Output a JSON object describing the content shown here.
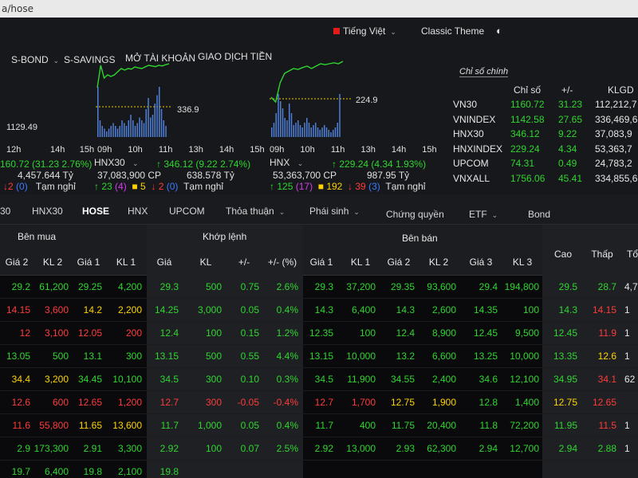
{
  "browser": {
    "url": "a/hose"
  },
  "header": {
    "lang_flag": "vn-flag-icon",
    "language": "Tiếng Việt",
    "theme": "Classic Theme",
    "menu": [
      "S-BOND",
      "S-SAVINGS",
      "MỞ TÀI KHOẢN",
      "GIAO DỊCH TIỀN"
    ]
  },
  "minicharts": [
    {
      "left_label": "1129.49",
      "time_labels": [
        "12h",
        "14h",
        "15h"
      ],
      "change": "160.72 (31.23 2.76%)",
      "volume": "4,457.644 Tỷ",
      "stats": {
        "down": "2",
        "down_b": "(0)",
        "status": "Tạm nghỉ"
      }
    },
    {
      "name": "HNX30",
      "ref_label": "336.9",
      "time_labels": [
        "09h",
        "10h",
        "11h",
        "13h",
        "14h",
        "15h"
      ],
      "change": "346.12 (9.22 2.74%)",
      "volume": "37,083,900 CP",
      "value": "638.578 Tỷ",
      "stats": {
        "up": "23",
        "up_b": "(4)",
        "ref": "5",
        "down": "2",
        "down_b": "(0)",
        "status": "Tạm nghỉ"
      }
    },
    {
      "name": "HNX",
      "ref_label": "224.9",
      "time_labels": [
        "09h",
        "10h",
        "11h",
        "13h",
        "14h",
        "15h"
      ],
      "change": "229.24 (4.34 1.93%)",
      "volume": "53,363,700 CP",
      "value": "987.95 Tỷ",
      "stats": {
        "up": "125",
        "up_b": "(17)",
        "ref": "192",
        "down": "39",
        "down_b": "(3)",
        "status": "Tạm nghỉ"
      }
    }
  ],
  "index_table": {
    "title": "Chỉ số chính",
    "headers": [
      "Chỉ số",
      "+/-",
      "KLGD"
    ],
    "rows": [
      [
        "VN30",
        "1160.72",
        "31.23",
        "112,212,7"
      ],
      [
        "VNINDEX",
        "1142.58",
        "27.65",
        "336,469,6"
      ],
      [
        "HNX30",
        "346.12",
        "9.22",
        "37,083,9"
      ],
      [
        "HNXINDEX",
        "229.24",
        "4.34",
        "53,363,7"
      ],
      [
        "UPCOM",
        "74.31",
        "0.49",
        "24,783,2"
      ],
      [
        "VNXALL",
        "1756.06",
        "45.41",
        "334,855,6"
      ]
    ]
  },
  "tabs": [
    "30",
    "HNX30",
    "HOSE",
    "HNX",
    "UPCOM",
    "Thỏa thuận",
    "Phái sinh",
    "Chứng quyền",
    "ETF",
    "Bond"
  ],
  "groups": {
    "buy": "Bên mua",
    "match": "Khớp lệnh",
    "sell": "Bên bán"
  },
  "columns": [
    "Giá 2",
    "KL 2",
    "Giá 1",
    "KL 1",
    "Giá",
    "KL",
    "+/-",
    "+/- (%)",
    "Giá 1",
    "KL 1",
    "Giá 2",
    "KL 2",
    "Giá 3",
    "KL 3",
    "Cao",
    "Thấp",
    "Tổ"
  ],
  "rows": [
    {
      "vals": [
        "29.2",
        "61,200",
        "29.25",
        "4,200",
        "29.3",
        "500",
        "0.75",
        "2.6%",
        "29.3",
        "37,200",
        "29.35",
        "93,600",
        "29.4",
        "194,800",
        "29.5",
        "28.7",
        "4,7"
      ],
      "cls": [
        "g",
        "g",
        "g",
        "g",
        "g",
        "g",
        "g",
        "g",
        "g",
        "g",
        "g",
        "g",
        "g",
        "g",
        "g",
        "g",
        "w"
      ]
    },
    {
      "vals": [
        "14.15",
        "3,600",
        "14.2",
        "2,200",
        "14.25",
        "3,000",
        "0.05",
        "0.4%",
        "14.3",
        "6,400",
        "14.3",
        "2,600",
        "14.35",
        "100",
        "14.3",
        "14.15",
        "1"
      ],
      "cls": [
        "r",
        "r",
        "y",
        "y",
        "g",
        "g",
        "g",
        "g",
        "g",
        "g",
        "g",
        "g",
        "g",
        "g",
        "g",
        "r",
        "w"
      ]
    },
    {
      "vals": [
        "12",
        "3,100",
        "12.05",
        "200",
        "12.4",
        "100",
        "0.15",
        "1.2%",
        "12.35",
        "100",
        "12.4",
        "8,900",
        "12.45",
        "9,500",
        "12.45",
        "11.9",
        "1"
      ],
      "cls": [
        "r",
        "r",
        "r",
        "r",
        "g",
        "g",
        "g",
        "g",
        "g",
        "g",
        "g",
        "g",
        "g",
        "g",
        "g",
        "r",
        "w"
      ]
    },
    {
      "vals": [
        "13.05",
        "500",
        "13.1",
        "300",
        "13.15",
        "500",
        "0.55",
        "4.4%",
        "13.15",
        "10,000",
        "13.2",
        "6,600",
        "13.25",
        "10,000",
        "13.35",
        "12.6",
        "1"
      ],
      "cls": [
        "g",
        "g",
        "g",
        "g",
        "g",
        "g",
        "g",
        "g",
        "g",
        "g",
        "g",
        "g",
        "g",
        "g",
        "g",
        "y",
        "w"
      ]
    },
    {
      "vals": [
        "34.4",
        "3,200",
        "34.45",
        "10,100",
        "34.5",
        "300",
        "0.10",
        "0.3%",
        "34.5",
        "11,900",
        "34.55",
        "2,400",
        "34.6",
        "12,100",
        "34.95",
        "34.1",
        "62"
      ],
      "cls": [
        "y",
        "y",
        "g",
        "g",
        "g",
        "g",
        "g",
        "g",
        "g",
        "g",
        "g",
        "g",
        "g",
        "g",
        "g",
        "r",
        "w"
      ]
    },
    {
      "vals": [
        "12.6",
        "600",
        "12.65",
        "1,200",
        "12.7",
        "300",
        "-0.05",
        "-0.4%",
        "12.7",
        "1,700",
        "12.75",
        "1,900",
        "12.8",
        "1,400",
        "12.75",
        "12.65",
        ""
      ],
      "cls": [
        "r",
        "r",
        "r",
        "r",
        "r",
        "r",
        "r",
        "r",
        "r",
        "r",
        "y",
        "y",
        "g",
        "g",
        "y",
        "r",
        "w"
      ]
    },
    {
      "vals": [
        "11.6",
        "55,800",
        "11.65",
        "13,600",
        "11.7",
        "1,000",
        "0.05",
        "0.4%",
        "11.7",
        "400",
        "11.75",
        "20,400",
        "11.8",
        "72,200",
        "11.95",
        "11.5",
        "1"
      ],
      "cls": [
        "r",
        "r",
        "y",
        "y",
        "g",
        "g",
        "g",
        "g",
        "g",
        "g",
        "g",
        "g",
        "g",
        "g",
        "g",
        "r",
        "w"
      ]
    },
    {
      "vals": [
        "2.9",
        "173,300",
        "2.91",
        "3,300",
        "2.92",
        "100",
        "0.07",
        "2.5%",
        "2.92",
        "13,000",
        "2.93",
        "62,300",
        "2.94",
        "12,700",
        "2.94",
        "2.88",
        "1"
      ],
      "cls": [
        "g",
        "g",
        "g",
        "g",
        "g",
        "g",
        "g",
        "g",
        "g",
        "g",
        "g",
        "g",
        "g",
        "g",
        "g",
        "g",
        "w"
      ]
    },
    {
      "vals": [
        "19.7",
        "6,400",
        "19.8",
        "2,100",
        "19.8",
        "",
        "",
        "",
        "",
        "",
        "",
        "",
        "",
        "",
        "",
        "",
        ""
      ],
      "cls": [
        "g",
        "g",
        "g",
        "g",
        "g",
        "g",
        "g",
        "g",
        "g",
        "g",
        "g",
        "g",
        "g",
        "g",
        "g",
        "g",
        "w"
      ]
    }
  ]
}
